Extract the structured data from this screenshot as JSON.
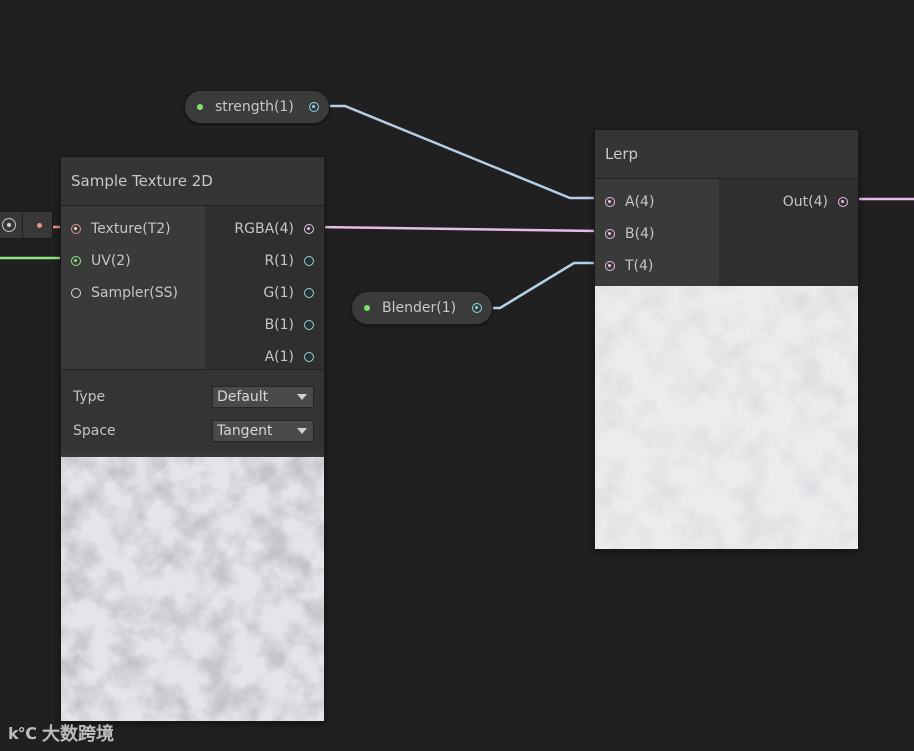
{
  "properties": {
    "strength": {
      "label": "strength(1)"
    },
    "blender": {
      "label": "Blender(1)"
    }
  },
  "sample_texture": {
    "title": "Sample Texture 2D",
    "inputs": [
      "Texture(T2)",
      "UV(2)",
      "Sampler(SS)"
    ],
    "outputs": [
      "RGBA(4)",
      "R(1)",
      "G(1)",
      "B(1)",
      "A(1)"
    ],
    "type_label": "Type",
    "type_value": "Default",
    "space_label": "Space",
    "space_value": "Tangent"
  },
  "lerp": {
    "title": "Lerp",
    "inputs": [
      "A(4)",
      "B(4)",
      "T(4)"
    ],
    "output": "Out(4)"
  },
  "colors": {
    "background": "#202020",
    "wire_float": "#84d8e6",
    "wire_vector4": "#e7bde8",
    "wire_vector2": "#8fe47e",
    "wire_texture": "#ef8f86"
  },
  "watermark": {
    "text": "大数跨境"
  }
}
